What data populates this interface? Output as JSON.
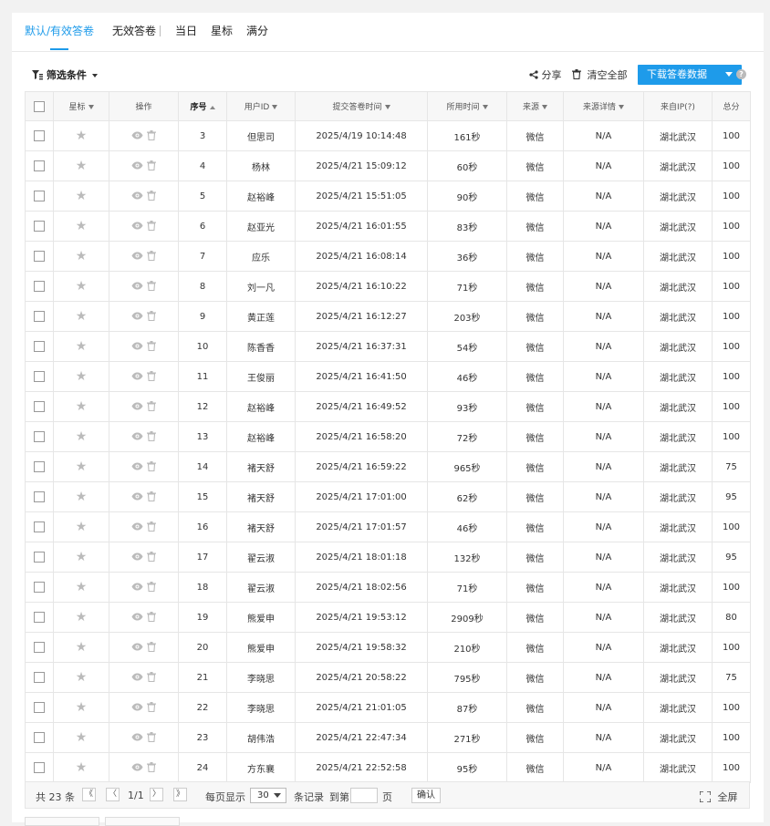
{
  "tabs": [
    {
      "label": "默认/有效答卷",
      "active": true
    },
    {
      "label": "无效答卷"
    },
    {
      "label": "当日"
    },
    {
      "label": "星标"
    },
    {
      "label": "满分"
    }
  ],
  "toolbar": {
    "filter_label": "筛选条件",
    "share_label": "分享",
    "clear_label": "清空全部",
    "download_label": "下载答卷数据",
    "help_label": "?"
  },
  "columns": [
    "星标",
    "操作",
    "序号",
    "用户ID",
    "提交答卷时间",
    "所用时间",
    "来源",
    "来源详情",
    "来自IP(?)",
    "总分"
  ],
  "rows": [
    [
      "3",
      "但思司",
      "2025/4/19 10:14:48",
      "161秒",
      "微信",
      "N/A",
      "湖北武汉",
      "100"
    ],
    [
      "4",
      "杨林",
      "2025/4/21 15:09:12",
      "60秒",
      "微信",
      "N/A",
      "湖北武汉",
      "100"
    ],
    [
      "5",
      "赵裕峰",
      "2025/4/21 15:51:05",
      "90秒",
      "微信",
      "N/A",
      "湖北武汉",
      "100"
    ],
    [
      "6",
      "赵亚光",
      "2025/4/21 16:01:55",
      "83秒",
      "微信",
      "N/A",
      "湖北武汉",
      "100"
    ],
    [
      "7",
      "应乐",
      "2025/4/21 16:08:14",
      "36秒",
      "微信",
      "N/A",
      "湖北武汉",
      "100"
    ],
    [
      "8",
      "刘一凡",
      "2025/4/21 16:10:22",
      "71秒",
      "微信",
      "N/A",
      "湖北武汉",
      "100"
    ],
    [
      "9",
      "黄正莲",
      "2025/4/21 16:12:27",
      "203秒",
      "微信",
      "N/A",
      "湖北武汉",
      "100"
    ],
    [
      "10",
      "陈香香",
      "2025/4/21 16:37:31",
      "54秒",
      "微信",
      "N/A",
      "湖北武汉",
      "100"
    ],
    [
      "11",
      "王俊丽",
      "2025/4/21 16:41:50",
      "46秒",
      "微信",
      "N/A",
      "湖北武汉",
      "100"
    ],
    [
      "12",
      "赵裕峰",
      "2025/4/21 16:49:52",
      "93秒",
      "微信",
      "N/A",
      "湖北武汉",
      "100"
    ],
    [
      "13",
      "赵裕峰",
      "2025/4/21 16:58:20",
      "72秒",
      "微信",
      "N/A",
      "湖北武汉",
      "100"
    ],
    [
      "14",
      "褚天舒",
      "2025/4/21 16:59:22",
      "965秒",
      "微信",
      "N/A",
      "湖北武汉",
      "75"
    ],
    [
      "15",
      "褚天舒",
      "2025/4/21 17:01:00",
      "62秒",
      "微信",
      "N/A",
      "湖北武汉",
      "95"
    ],
    [
      "16",
      "褚天舒",
      "2025/4/21 17:01:57",
      "46秒",
      "微信",
      "N/A",
      "湖北武汉",
      "100"
    ],
    [
      "17",
      "翟云淑",
      "2025/4/21 18:01:18",
      "132秒",
      "微信",
      "N/A",
      "湖北武汉",
      "95"
    ],
    [
      "18",
      "翟云淑",
      "2025/4/21 18:02:56",
      "71秒",
      "微信",
      "N/A",
      "湖北武汉",
      "100"
    ],
    [
      "19",
      "熊爱申",
      "2025/4/21 19:53:12",
      "2909秒",
      "微信",
      "N/A",
      "湖北武汉",
      "80"
    ],
    [
      "20",
      "熊爱申",
      "2025/4/21 19:58:32",
      "210秒",
      "微信",
      "N/A",
      "湖北武汉",
      "100"
    ],
    [
      "21",
      "李晓思",
      "2025/4/21 20:58:22",
      "795秒",
      "微信",
      "N/A",
      "湖北武汉",
      "75"
    ],
    [
      "22",
      "李晓思",
      "2025/4/21 21:01:05",
      "87秒",
      "微信",
      "N/A",
      "湖北武汉",
      "100"
    ],
    [
      "23",
      "胡伟浩",
      "2025/4/21 22:47:34",
      "271秒",
      "微信",
      "N/A",
      "湖北武汉",
      "100"
    ],
    [
      "24",
      "方东襄",
      "2025/4/21 22:52:58",
      "95秒",
      "微信",
      "N/A",
      "湖北武汉",
      "100"
    ]
  ],
  "pager": {
    "total_prefix": "共",
    "total": "23",
    "total_suffix": "条",
    "first": "《",
    "prev": "〈",
    "page": "1/1",
    "next": "〉",
    "last": "》",
    "per_page_label": "每页显示",
    "per_page": "30",
    "records_label": "条记录",
    "goto_label": "到第",
    "page_label": "页",
    "confirm": "确认",
    "fullscreen": "全屏"
  },
  "colors": {
    "accent": "#1e9bea"
  }
}
